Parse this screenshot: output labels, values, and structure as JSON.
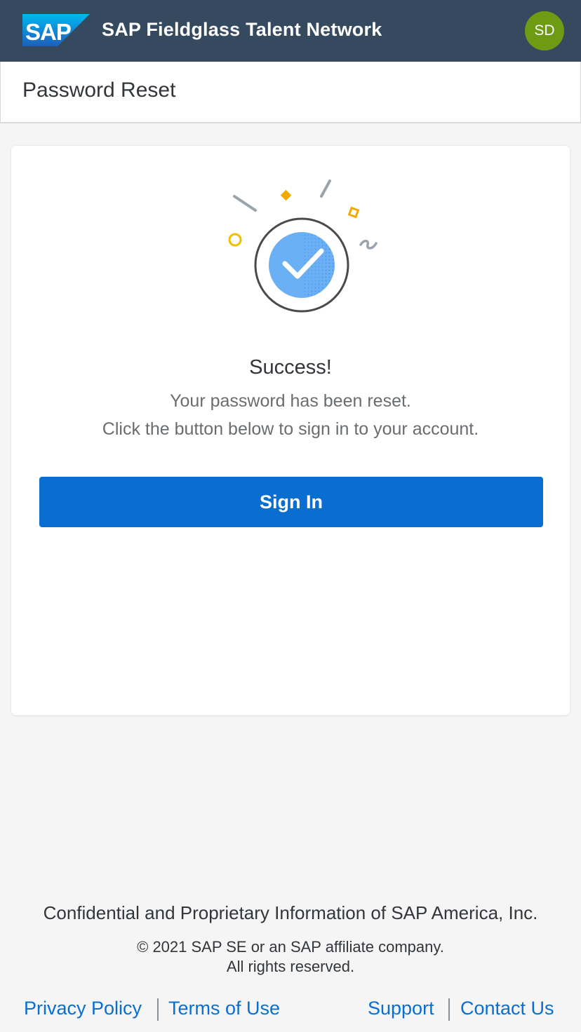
{
  "shell": {
    "logo_text": "SAP",
    "app_title": "SAP Fieldglass Talent Network",
    "avatar_initials": "SD",
    "brand_color": "#354a5f",
    "avatar_color": "#6e9b14"
  },
  "page": {
    "title": "Password Reset"
  },
  "card": {
    "illustration_icon": "success-checkmark-illustration",
    "success_title": "Success!",
    "message_line1": "Your password has been reset.",
    "message_line2": "Click the button below to sign in to your account.",
    "signin_label": "Sign In",
    "button_color": "#0a6ed1"
  },
  "footer": {
    "confidential": "Confidential and Proprietary Information of SAP America, Inc.",
    "copyright": "© 2021 SAP SE or an SAP affiliate company.",
    "rights": "All rights reserved.",
    "links": {
      "privacy": "Privacy Policy",
      "terms": "Terms of Use",
      "support": "Support",
      "contact": "Contact Us"
    },
    "link_color": "#0a6ed1"
  }
}
